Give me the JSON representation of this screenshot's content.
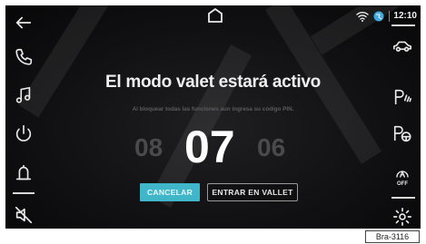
{
  "status_bar": {
    "time": "12:10"
  },
  "main": {
    "title": "El modo  valet estará activo",
    "subtitle": "Al bloquear todas las funciones aún ingresa su código PIN.",
    "picker": {
      "prev": "08",
      "current": "07",
      "next": "06"
    },
    "cancel_label": "CANCELAR",
    "enter_label": "ENTRAR EN VALLET"
  },
  "right_sidebar": {
    "auto_off_label": "OFF"
  },
  "figure_ref": "Bra-3116",
  "colors": {
    "accent": "#3fb6c9",
    "background": "#111113"
  }
}
